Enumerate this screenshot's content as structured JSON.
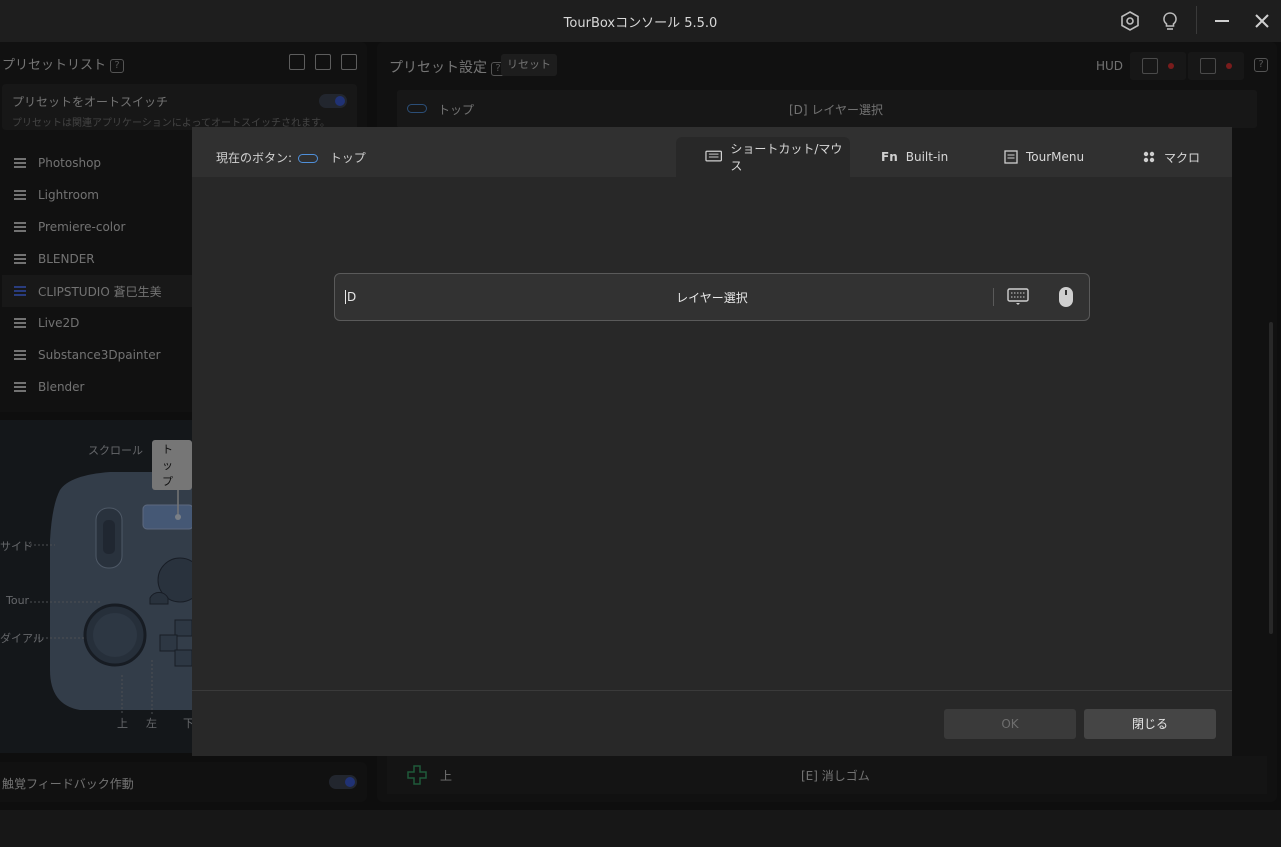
{
  "window": {
    "title": "TourBoxコンソール 5.5.0"
  },
  "titlebar_icons": [
    "settings-hex-icon",
    "lightbulb-icon",
    "minimize-icon",
    "close-icon"
  ],
  "preset_list": {
    "title": "プリセットリスト",
    "help": "?",
    "auto_switch_title": "プリセットをオートスイッチ",
    "auto_switch_desc": "プリセットは関連アプリケーションによってオートスイッチされます。",
    "items": [
      {
        "label": "Photoshop"
      },
      {
        "label": "Lightroom"
      },
      {
        "label": "Premiere-color"
      },
      {
        "label": "BLENDER"
      },
      {
        "label": "CLIPSTUDIO 蒼巳生美"
      },
      {
        "label": "Live2D"
      },
      {
        "label": "Substance3Dpainter"
      },
      {
        "label": "Blender"
      }
    ],
    "selected_index": 4
  },
  "device": {
    "labels": {
      "scroll": "スクロール",
      "top": "トップ",
      "side": "サイド",
      "tour": "Tour",
      "dial": "ダイアル",
      "up": "上",
      "left": "左",
      "down": "下"
    }
  },
  "haptic": {
    "label": "触覚フィードバック作動"
  },
  "preset_settings": {
    "title": "プリセット設定",
    "help": "?",
    "reset": "リセット",
    "hud": "HUD",
    "rows": [
      {
        "button": "トップ",
        "action": "[D] レイヤー選択"
      },
      {
        "button": "上",
        "action": "[E] 消しゴム"
      }
    ]
  },
  "modal": {
    "current_button_label": "現在のボタン:",
    "current_button_name": "トップ",
    "tabs": [
      {
        "label": "ショートカット/マウス",
        "icon": "keyboard-mouse-icon"
      },
      {
        "label": "Built-in",
        "icon": "Fn"
      },
      {
        "label": "TourMenu",
        "icon": "tourmenu-icon"
      },
      {
        "label": "マクロ",
        "icon": "macro-icon"
      }
    ],
    "shortcut": {
      "key": "D",
      "action": "レイヤー選択"
    },
    "ok": "OK",
    "close": "閉じる"
  },
  "colors": {
    "accent": "#3b5bd6",
    "pill": "#4f8fd9",
    "record_dot": "#dd3333"
  }
}
